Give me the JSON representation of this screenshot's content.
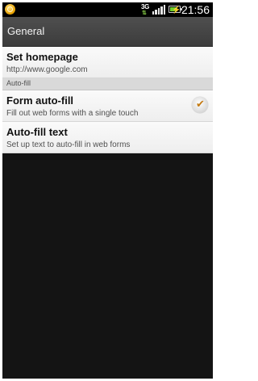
{
  "status_bar": {
    "network_type": "3G",
    "network_activity": "⇅",
    "time": "21:56",
    "notification_icon": "app-notification-icon",
    "signal_bars": [
      4,
      6,
      8,
      10,
      12
    ],
    "battery_level": 0.85
  },
  "header": {
    "title": "General"
  },
  "settings": {
    "homepage": {
      "label": "Set homepage",
      "summary": "http://www.google.com"
    },
    "autofill_section": "Auto-fill",
    "form_autofill": {
      "label": "Form auto-fill",
      "summary": "Fill out web forms with a single touch",
      "checked": true,
      "check_glyph": "✔"
    },
    "autofill_text": {
      "label": "Auto-fill text",
      "summary": "Set up text to auto-fill in web forms"
    }
  },
  "colors": {
    "accent_check": "#c47a12",
    "battery": "#6fcf2c",
    "background": "#141414"
  }
}
